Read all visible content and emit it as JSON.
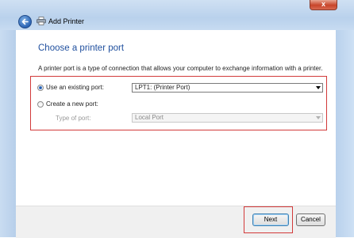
{
  "window": {
    "title": "Add Printer",
    "close_glyph": "x"
  },
  "icons": {
    "back": "back-arrow-icon",
    "printer": "printer-icon",
    "dropdown": "chevron-down-icon"
  },
  "colors": {
    "heading": "#1f4f9e",
    "highlight_box": "#d23a3a"
  },
  "page": {
    "heading": "Choose a printer port",
    "description": "A printer port is a type of connection that allows your computer to exchange information with a printer."
  },
  "options": {
    "existing": {
      "label": "Use an existing port:",
      "selected": true,
      "value": "LPT1: (Printer Port)"
    },
    "new": {
      "label": "Create a new port:",
      "selected": false,
      "type_label": "Type of port:",
      "type_value": "Local Port"
    }
  },
  "buttons": {
    "next": "Next",
    "cancel": "Cancel"
  }
}
